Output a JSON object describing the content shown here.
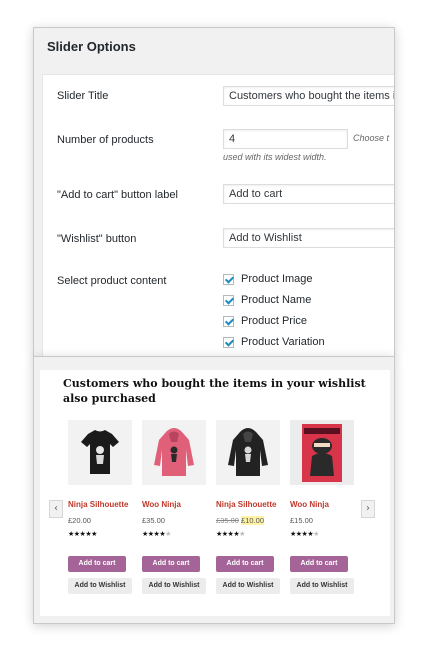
{
  "admin": {
    "panel_title": "Slider Options",
    "fields": {
      "slider_title_label": "Slider Title",
      "slider_title_value": "Customers who bought the items in",
      "num_products_label": "Number of products",
      "num_products_value": "4",
      "num_products_hint_right": "Choose t",
      "num_products_hint_below": "used with its widest width.",
      "add_to_cart_label": "\"Add to cart\" button label",
      "add_to_cart_value": "Add to cart",
      "wishlist_label": "\"Wishlist\" button",
      "wishlist_value": "Add to Wishlist",
      "content_label": "Select product content"
    },
    "checkboxes": [
      {
        "label": "Product Image",
        "checked": true
      },
      {
        "label": "Product Name",
        "checked": true
      },
      {
        "label": "Product Price",
        "checked": true
      },
      {
        "label": "Product Variation",
        "checked": true
      }
    ]
  },
  "slider": {
    "heading": "Customers who bought the items in your wishlist also purchased",
    "prev_arrow": "‹",
    "next_arrow": "›",
    "products": [
      {
        "name": "Ninja Silhouette",
        "price": "£20.00",
        "price_old": "",
        "price_new": "",
        "stars_filled": "★★★★★",
        "stars_empty": "",
        "cart_label": "Add to cart",
        "wishlist_label": "Add to Wishlist",
        "image": "black-ninja-tshirt"
      },
      {
        "name": "Woo Ninja",
        "price": "£35.00",
        "price_old": "",
        "price_new": "",
        "stars_filled": "★★★★",
        "stars_empty": "★",
        "cart_label": "Add to cart",
        "wishlist_label": "Add to Wishlist",
        "image": "pink-ninja-hoodie"
      },
      {
        "name": "Ninja Silhouette",
        "price": "",
        "price_old": "£35.00",
        "price_new": "£10.00",
        "stars_filled": "★★★★",
        "stars_empty": "★",
        "cart_label": "Add to cart",
        "wishlist_label": "Add to Wishlist",
        "image": "black-ninja-hoodie"
      },
      {
        "name": "Woo Ninja",
        "price": "£15.00",
        "price_old": "",
        "price_new": "",
        "stars_filled": "★★★★",
        "stars_empty": "★",
        "cart_label": "Add to cart",
        "wishlist_label": "Add to Wishlist",
        "image": "red-ninja-poster"
      }
    ]
  },
  "colors": {
    "accent_purple": "#a46497",
    "product_name_red": "#c0392b",
    "checkbox_blue": "#1e8cbe"
  }
}
